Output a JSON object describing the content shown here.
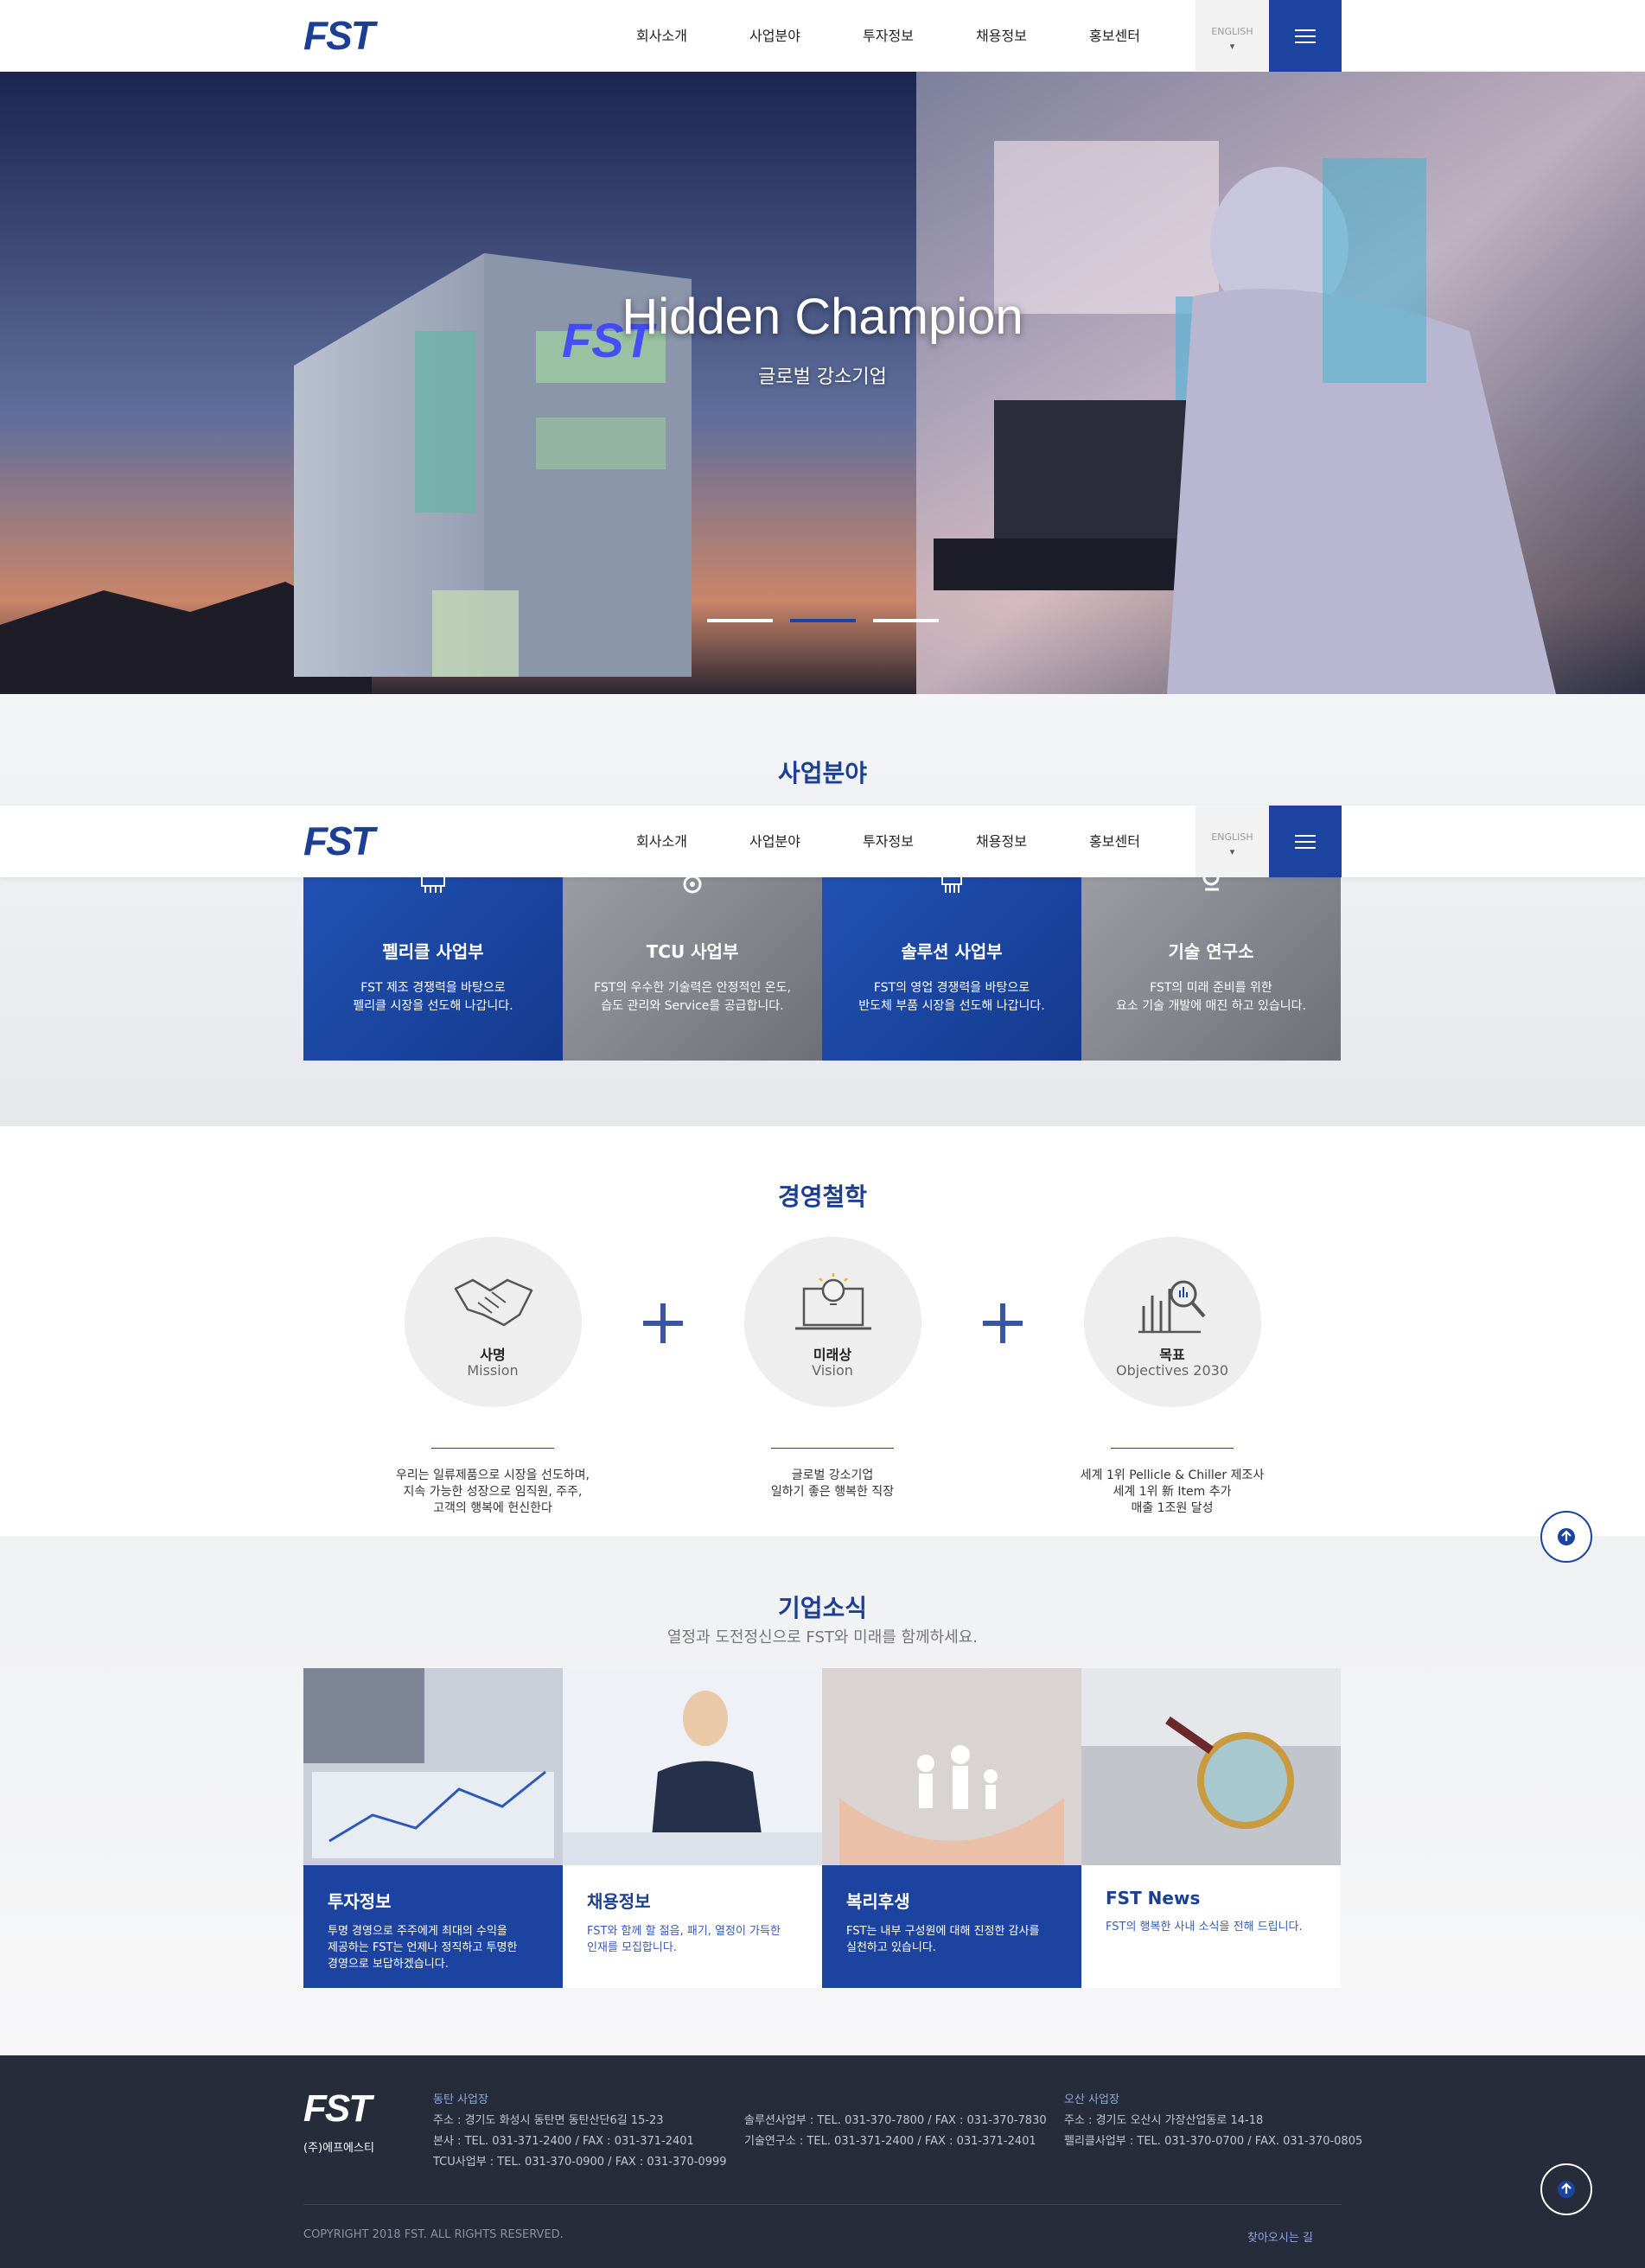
{
  "brand": {
    "logo": "FST",
    "accent": "#1c43a0",
    "footer_bg": "#262c3a"
  },
  "nav": {
    "items": [
      "회사소개",
      "사업분야",
      "투자정보",
      "채용정보",
      "홍보센터"
    ],
    "lang": "ENGLISH",
    "lang_arrow": "▾",
    "menu_icon": "hamburger-icon"
  },
  "hero": {
    "title": "Hidden Champion",
    "subtitle": "글로벌 강소기업",
    "slides": 3,
    "active_slide": 2
  },
  "business": {
    "title": "사업분야",
    "cards": [
      {
        "name": "펠리클 사업부",
        "desc": "FST 제조 경쟁력을 바탕으로\n펠리클 시장을 선도해 나갑니다.",
        "icon": "chip-icon"
      },
      {
        "name": "TCU 사업부",
        "desc": "FST의 우수한 기술력은 안정적인 온도,\n습도 관리와 Service를 공급합니다.",
        "icon": "thermometer-icon"
      },
      {
        "name": "솔루션 사업부",
        "desc": "FST의 영업 경쟁력을 바탕으로\n반도체 부품 시장을 선도해 나갑니다.",
        "icon": "processor-icon"
      },
      {
        "name": "기술 연구소",
        "desc": "FST의 미래 준비를 위한\n요소 기술 개발에 매진 하고 있습니다.",
        "icon": "microscope-icon"
      }
    ]
  },
  "philosophy": {
    "title": "경영철학",
    "items": [
      {
        "ko": "사명",
        "en": "Mission",
        "desc": "우리는 일류제품으로 시장을 선도하며,\n지속 가능한 성장으로 임직원, 주주,\n고객의 행복에 헌신한다",
        "icon": "handshake-icon"
      },
      {
        "ko": "미래상",
        "en": "Vision",
        "desc": "글로벌 강소기업\n일하기 좋은 행복한 직장",
        "icon": "laptop-idea-icon"
      },
      {
        "ko": "목표",
        "en": "Objectives 2030",
        "desc": "세계 1위 Pellicle & Chiller 제조사\n세계 1위 新 Item 추가\n매출 1조원 달성",
        "icon": "chart-search-icon"
      }
    ]
  },
  "news": {
    "title": "기업소식",
    "subtitle": "열정과 도전정신으로 FST와 미래를 함께하세요.",
    "cards": [
      {
        "title": "투자정보",
        "desc": "투명 경영으로 주주에게 최대의 수익을\n제공하는 FST는 언제나 정직하고 투명한\n경영으로 보답하겠습니다.",
        "style": "blue"
      },
      {
        "title": "채용정보",
        "desc": "FST와 함께 할 젊음, 패기, 열정이 가득한\n인재를 모집합니다.",
        "style": "white"
      },
      {
        "title": "복리후생",
        "desc": "FST는 내부 구성원에 대해 진정한 감사를\n실천하고 있습니다.",
        "style": "blue"
      },
      {
        "title": "FST News",
        "desc": "FST의 행복한 사내 소식을 전해 드립니다.",
        "style": "white"
      }
    ]
  },
  "footer": {
    "logo": "FST",
    "company": "(주)에프에스티",
    "col1_head": "동탄 사업장",
    "col1": "주소 : 경기도 화성시 동탄면 동탄산단6길 15-23\n본사 : TEL. 031-371-2400 / FAX : 031-371-2401\nTCU사업부 : TEL. 031-370-0900 / FAX : 031-370-0999",
    "col2": "솔루션사업부 : TEL. 031-370-7800 / FAX : 031-370-7830\n기술연구소 : TEL. 031-371-2400 / FAX : 031-371-2401",
    "col3_head": "오산 사업장",
    "col3": "주소 : 경기도 오산시 가장산업동로 14-18\n펠리클사업부 : TEL. 031-370-0700 / FAX. 031-370-0805",
    "copyright": "COPYRIGHT 2018 FST. ALL RIGHTS RESERVED.",
    "map_link": "찾아오시는 길"
  }
}
